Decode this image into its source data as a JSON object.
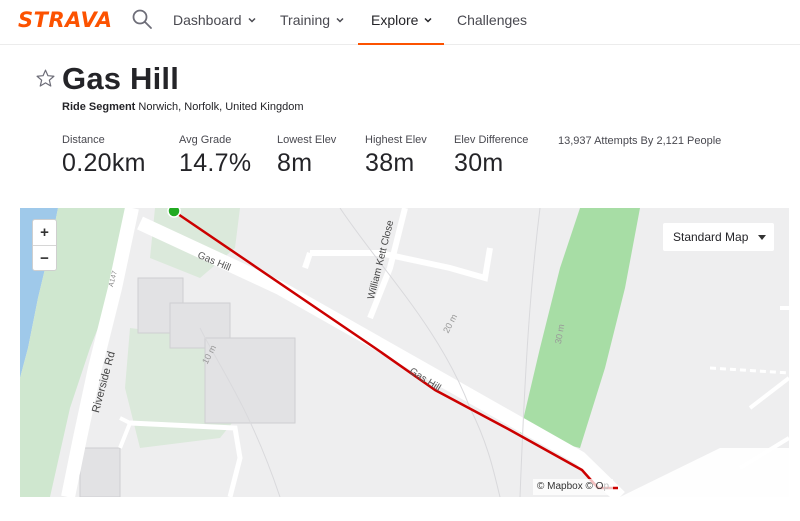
{
  "nav": {
    "logo": "STRAVA",
    "items": [
      {
        "label": "Dashboard",
        "has_menu": true
      },
      {
        "label": "Training",
        "has_menu": true
      },
      {
        "label": "Explore",
        "has_menu": true,
        "active": true
      },
      {
        "label": "Challenges",
        "has_menu": false
      }
    ]
  },
  "segment": {
    "name": "Gas Hill",
    "type_label": "Ride Segment",
    "location": "Norwich, Norfolk, United Kingdom"
  },
  "stats": [
    {
      "label": "Distance",
      "value": "0.20km"
    },
    {
      "label": "Avg Grade",
      "value": "14.7%"
    },
    {
      "label": "Lowest Elev",
      "value": "8m"
    },
    {
      "label": "Highest Elev",
      "value": "38m"
    },
    {
      "label": "Elev Difference",
      "value": "30m"
    }
  ],
  "attempts": "13,937 Attempts By 2,121 People",
  "map": {
    "zoom_in": "+",
    "zoom_out": "−",
    "map_type": "Standard Map",
    "attribution": "© Mapbox © O",
    "attribution_overflow": "p",
    "labels": {
      "gas_hill_1": "Gas Hill",
      "gas_hill_2": "Gas Hill",
      "riverside": "Riverside Rd",
      "william": "William Kett Close",
      "a1": "A147",
      "c20": "20 m",
      "c30": "30 m",
      "c10": "10 m"
    }
  },
  "colors": {
    "brand": "#fc5200",
    "route": "#cc0000",
    "start_marker": "#22aa22",
    "park": "#a7dda5",
    "water": "#9fc9ea"
  }
}
